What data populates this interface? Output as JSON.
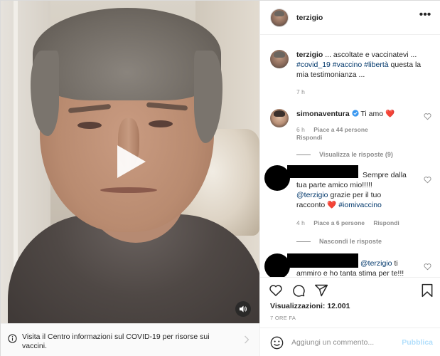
{
  "post": {
    "username": "terzigio",
    "more_icon": "more-horizontal-icon",
    "caption_user": "terzigio",
    "caption_text": "... ascoltate e vaccinatevi ...",
    "caption_hashtags": "#covid_19 #vaccino #libertà",
    "caption_tail": "questa la mia testimonianza ...",
    "caption_time": "7 h"
  },
  "video": {
    "play_icon": "play-icon",
    "sound_icon": "speaker-icon"
  },
  "covid_banner": {
    "text": "Visita il Centro informazioni sul COVID-19 per risorse sui vaccini.",
    "info_icon": "info-icon",
    "chevron_icon": "chevron-right-icon"
  },
  "comments": [
    {
      "username": "simonaventura",
      "verified_icon": "verified-badge-icon",
      "text": "Ti amo",
      "emoji": "❤️",
      "time": "6 h",
      "likes": "Piace a 44 persone",
      "reply": "Rispondi",
      "replies_toggle": "Visualizza le risposte (9)"
    },
    {
      "username": "",
      "text_line1": "Sempre dalla",
      "text_line2": "tua parte amico mio!!!!!",
      "mention": "@terzigio",
      "text_line3": "grazie per il tuo",
      "text_line4": "racconto",
      "emoji": "❤️",
      "hashtag": "#iomivaccino",
      "time": "4 h",
      "likes": "Piace a 6 persone",
      "reply": "Rispondi",
      "replies_toggle": "Nascondi le risposte"
    },
    {
      "username": "",
      "mention": "@terzigio",
      "text_tail": "ti",
      "text_line2": "ammiro e ho tanta stima per te!!!"
    }
  ],
  "actions": {
    "like_icon": "heart-icon",
    "comment_icon": "comment-icon",
    "share_icon": "share-icon",
    "save_icon": "bookmark-icon"
  },
  "stats": {
    "views_label": "Visualizzazioni:",
    "views_value": "12.001",
    "posted": "7 ORE FA"
  },
  "comment_box": {
    "emoji_icon": "emoji-icon",
    "placeholder": "Aggiungi un commento...",
    "publish_label": "Pubblica"
  },
  "colors": {
    "hashtag": "#00376b",
    "muted": "#8e8e8e",
    "publish_disabled": "#b2dffc",
    "heart": "#ed4956"
  }
}
